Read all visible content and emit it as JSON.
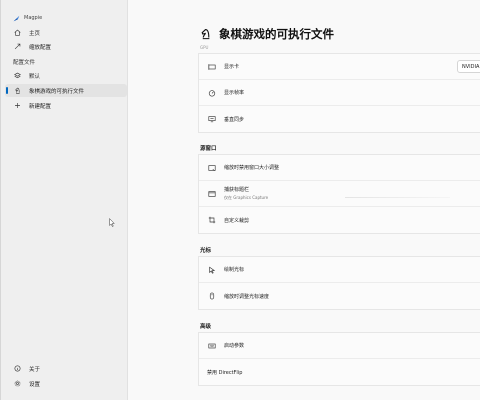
{
  "app": {
    "title": "Magpie"
  },
  "sidebar": {
    "items": [
      {
        "label": "主页",
        "icon": "home-icon"
      },
      {
        "label": "缩放配置",
        "icon": "scale-arrow-icon"
      }
    ],
    "profiles_label": "配置文件",
    "profiles": [
      {
        "label": "默认",
        "icon": "layers-icon"
      },
      {
        "label": "象棋游戏的可执行文件",
        "icon": "chess-knight-icon",
        "selected": true
      },
      {
        "label": "新建配置",
        "icon": "plus-icon"
      }
    ],
    "footer": [
      {
        "label": "关于",
        "icon": "info-icon"
      },
      {
        "label": "设置",
        "icon": "gear-icon"
      }
    ]
  },
  "main": {
    "title": "象棋游戏的可执行文件",
    "faint_header": "GPU",
    "card1": {
      "rows": [
        {
          "label": "显示卡",
          "icon": "display-card-icon",
          "dropdown": "NVIDIA"
        },
        {
          "label": "显示帧率",
          "icon": "speedometer-icon"
        },
        {
          "label": "垂直同步",
          "icon": "monitor-sync-icon"
        }
      ]
    },
    "section_window": "源窗口",
    "card2": {
      "rows": [
        {
          "label": "缩放时禁用窗口大小调整",
          "icon": "window-resize-icon"
        },
        {
          "label": "捕获标题栏",
          "sub": "仅在 Graphics Capture",
          "icon": "titlebar-icon"
        },
        {
          "label": "自定义裁剪",
          "icon": "crop-icon"
        }
      ]
    },
    "section_cursor": "光标",
    "card3": {
      "rows": [
        {
          "label": "绘制光标",
          "icon": "cursor-draw-icon"
        },
        {
          "label": "缩放时调整光标速度",
          "icon": "mouse-icon"
        }
      ]
    },
    "section_advanced": "高级",
    "card4": {
      "rows": [
        {
          "label": "启动参数",
          "icon": "keyboard-icon"
        },
        {
          "label": "禁用 DirectFlip"
        }
      ]
    }
  }
}
